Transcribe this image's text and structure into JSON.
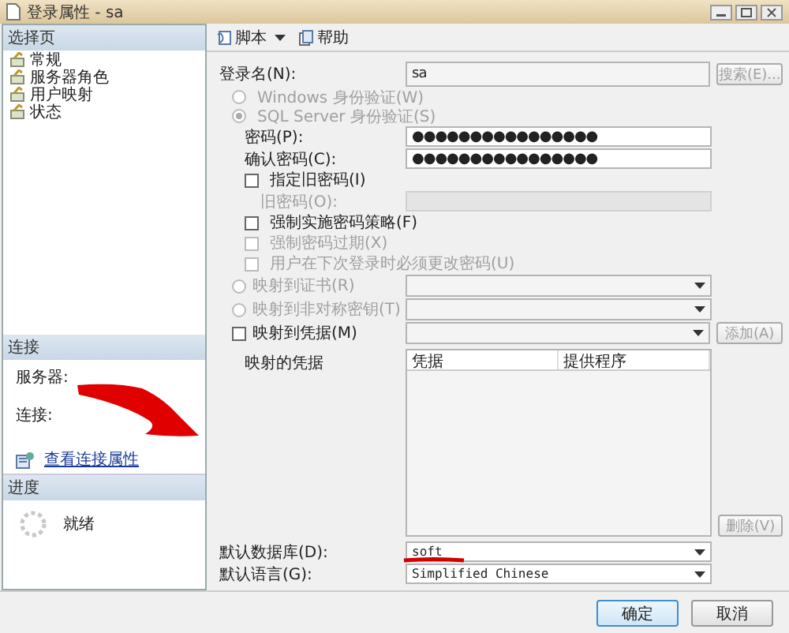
{
  "window": {
    "title": "登录属性 - sa"
  },
  "select_page": {
    "header": "选择页",
    "items": [
      {
        "label": "常规"
      },
      {
        "label": "服务器角色"
      },
      {
        "label": "用户映射"
      },
      {
        "label": "状态"
      }
    ]
  },
  "connection": {
    "header": "连接",
    "server_label": "服务器:",
    "connection_label": "连接:",
    "link": "查看连接属性"
  },
  "progress": {
    "header": "进度",
    "status": "就绪"
  },
  "toolbar": [
    {
      "label": "脚本",
      "dropdown": true
    },
    {
      "label": "帮助",
      "dropdown": false
    }
  ],
  "login_name": {
    "label": "登录名(N):",
    "value": "sa",
    "button": "搜索(E)...",
    "button_disabled": true
  },
  "auth": [
    {
      "label": "Windows 身份验证(W)",
      "selected": false,
      "disabled": true
    },
    {
      "label": "SQL Server 身份验证(S)",
      "selected": true,
      "disabled": true
    }
  ],
  "password": {
    "label": "密码(P):",
    "value": "●●●●●●●●●●●●●●●●"
  },
  "confirm_password": {
    "label": "确认密码(C):",
    "value": "●●●●●●●●●●●●●●●●"
  },
  "old_password": {
    "checkbox": {
      "label": "指定旧密码(I)",
      "checked": false,
      "disabled": false
    },
    "label": "旧密码(O):",
    "disabled": true
  },
  "policies": [
    {
      "label": "强制实施密码策略(F)",
      "checked": false,
      "disabled": false
    },
    {
      "label": "强制密码过期(X)",
      "checked": false,
      "disabled": true
    },
    {
      "label": "用户在下次登录时必须更改密码(U)",
      "checked": false,
      "disabled": true
    }
  ],
  "mappings": [
    {
      "kind": "radio",
      "label": "映射到证书(R)",
      "selected": false,
      "disabled": true
    },
    {
      "kind": "radio",
      "label": "映射到非对称密钥(T)",
      "selected": false,
      "disabled": true
    },
    {
      "kind": "checkbox",
      "label": "映射到凭据(M)",
      "checked": false,
      "disabled": false,
      "button": "添加(A)"
    }
  ],
  "mapped_credentials": {
    "label": "映射的凭据",
    "columns": [
      "凭据",
      "提供程序"
    ],
    "button": "删除(V)"
  },
  "default_database": {
    "label": "默认数据库(D):",
    "value": "soft"
  },
  "default_language": {
    "label": "默认语言(G):",
    "value": "Simplified Chinese"
  },
  "buttons": [
    {
      "label": "确定",
      "default": true
    },
    {
      "label": "取消",
      "default": false
    }
  ]
}
